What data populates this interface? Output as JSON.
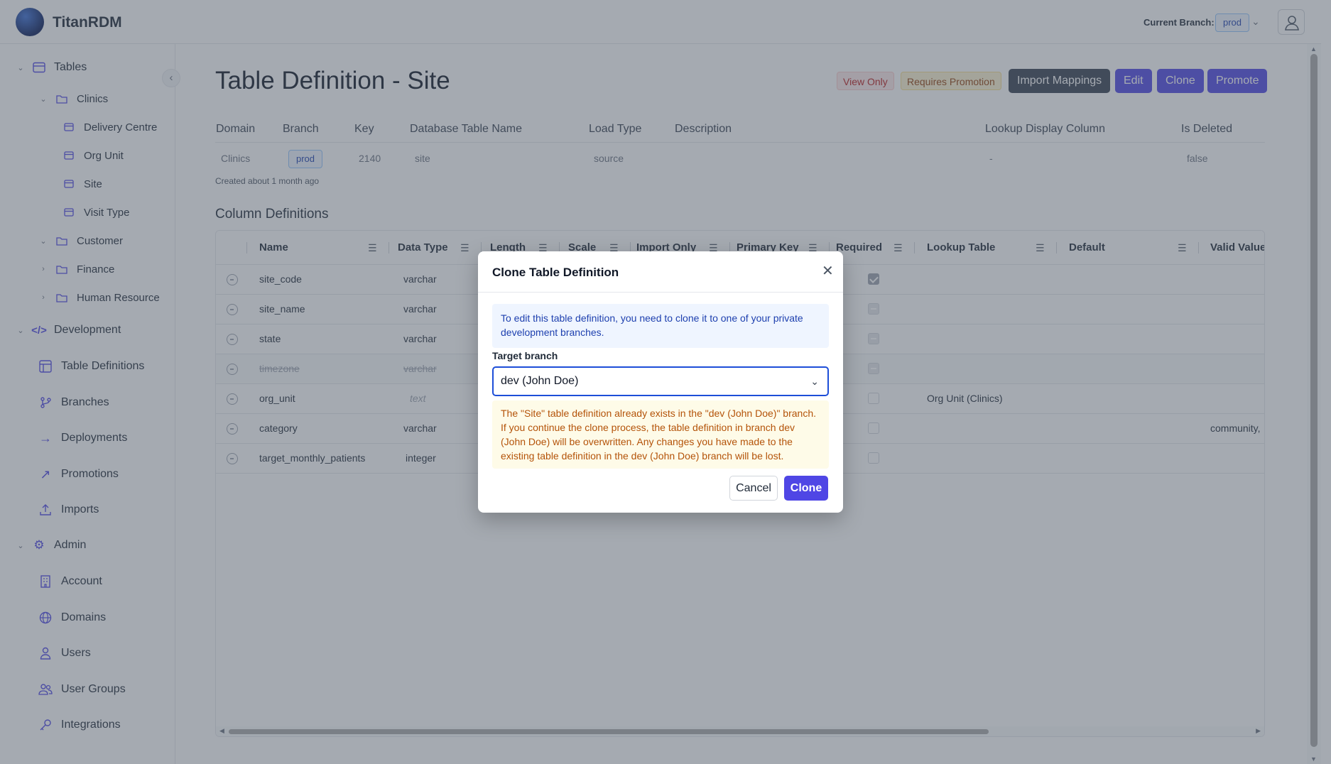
{
  "app": {
    "name": "TitanRDM"
  },
  "header": {
    "branch_label": "Current Branch:",
    "branch_value": "prod"
  },
  "sidebar": {
    "tables_label": "Tables",
    "tree": [
      {
        "label": "Clinics"
      },
      {
        "label": "Delivery Centre"
      },
      {
        "label": "Org Unit"
      },
      {
        "label": "Site"
      },
      {
        "label": "Visit Type"
      },
      {
        "label": "Customer"
      },
      {
        "label": "Finance"
      },
      {
        "label": "Human Resource"
      }
    ],
    "development_label": "Development",
    "development_items": [
      "Table Definitions",
      "Branches",
      "Deployments",
      "Promotions",
      "Imports"
    ],
    "admin_label": "Admin",
    "admin_items": [
      "Account",
      "Domains",
      "Users",
      "User Groups",
      "Integrations"
    ]
  },
  "page": {
    "title": "Table Definition - Site",
    "badges": {
      "view_only": "View Only",
      "requires_promotion": "Requires Promotion"
    },
    "buttons": {
      "import_mappings": "Import Mappings",
      "edit": "Edit",
      "clone": "Clone",
      "promote": "Promote"
    },
    "meta_headers": [
      "Domain",
      "Branch",
      "Key",
      "Database Table Name",
      "Load Type",
      "Description",
      "Lookup Display Column",
      "Is Deleted"
    ],
    "meta_values": {
      "domain": "Clinics",
      "branch": "prod",
      "key": "2140",
      "db_table": "site",
      "load_type": "source",
      "lookup_display": "-",
      "is_deleted": "false"
    },
    "created": "Created about 1 month ago",
    "column_definitions_title": "Column Definitions"
  },
  "grid": {
    "headers": [
      "Name",
      "Data Type",
      "Length",
      "Scale",
      "Import Only",
      "Primary Key",
      "Required",
      "Lookup Table",
      "Default",
      "Valid Values"
    ],
    "rows": [
      {
        "name": "site_code",
        "type": "varchar",
        "lookup": "",
        "valid": ""
      },
      {
        "name": "site_name",
        "type": "varchar",
        "lookup": "",
        "valid": ""
      },
      {
        "name": "state",
        "type": "varchar",
        "lookup": "",
        "valid": ""
      },
      {
        "name": "timezone",
        "type": "varchar",
        "lookup": "",
        "valid": ""
      },
      {
        "name": "org_unit",
        "type": "text",
        "lookup": "Org Unit (Clinics)",
        "valid": ""
      },
      {
        "name": "category",
        "type": "varchar",
        "lookup": "",
        "valid": "community,"
      },
      {
        "name": "target_monthly_patients",
        "type": "integer",
        "lookup": "",
        "valid": ""
      }
    ]
  },
  "modal": {
    "title": "Clone Table Definition",
    "info": "To edit this table definition, you need to clone it to one of your private development branches.",
    "target_label": "Target branch",
    "target_value": "dev (John Doe)",
    "warning": "The \"Site\" table definition already exists in the \"dev (John Doe)\" branch. If you continue the clone process, the table definition in branch dev (John Doe) will be overwritten. Any changes you have made to the existing table definition in the dev (John Doe) branch will be lost.",
    "cancel": "Cancel",
    "clone": "Clone"
  },
  "colors": {
    "primary": "#4f46e5",
    "dark_button": "#374151",
    "overlay": "rgba(75,85,99,0.5)",
    "warning_text": "#b45309",
    "info_text": "#1e40af"
  }
}
